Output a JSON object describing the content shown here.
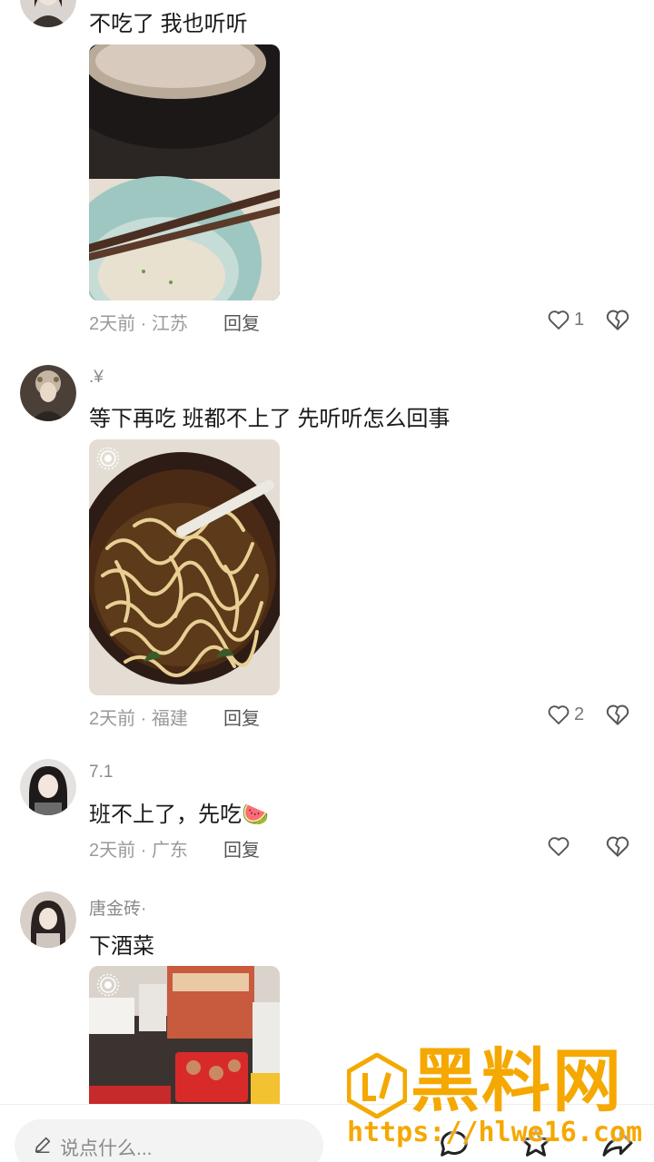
{
  "comments": [
    {
      "username": "",
      "text": "不吃了 我也听听",
      "meta": "2天前 · 江苏",
      "reply_label": "回复",
      "likes": "1",
      "photo_desc": "bowl of porridge with chopsticks"
    },
    {
      "username": ".¥",
      "text": "等下再吃 班都不上了 先听听怎么回事",
      "meta": "2天前 · 福建",
      "reply_label": "回复",
      "likes": "2",
      "photo_desc": "instant noodles"
    },
    {
      "username": "7.1",
      "text": "班不上了，先吃",
      "emoji": "🍉",
      "meta": "2天前 · 广东",
      "reply_label": "回复",
      "likes": ""
    },
    {
      "username": "唐金砖·",
      "text": "下酒菜",
      "photo_desc": "snacks on table"
    }
  ],
  "input": {
    "placeholder": "说点什么..."
  },
  "watermark": {
    "title": "黑料网",
    "url": "https://hlwe16.com"
  },
  "colors": {
    "accent": "#f5a800",
    "meta": "#9a9a9a",
    "text": "#1a1a1a"
  },
  "icons": [
    "heart-icon",
    "broken-heart-icon",
    "pen-icon",
    "comment-icon",
    "star-icon",
    "share-icon",
    "live-photo-icon"
  ]
}
